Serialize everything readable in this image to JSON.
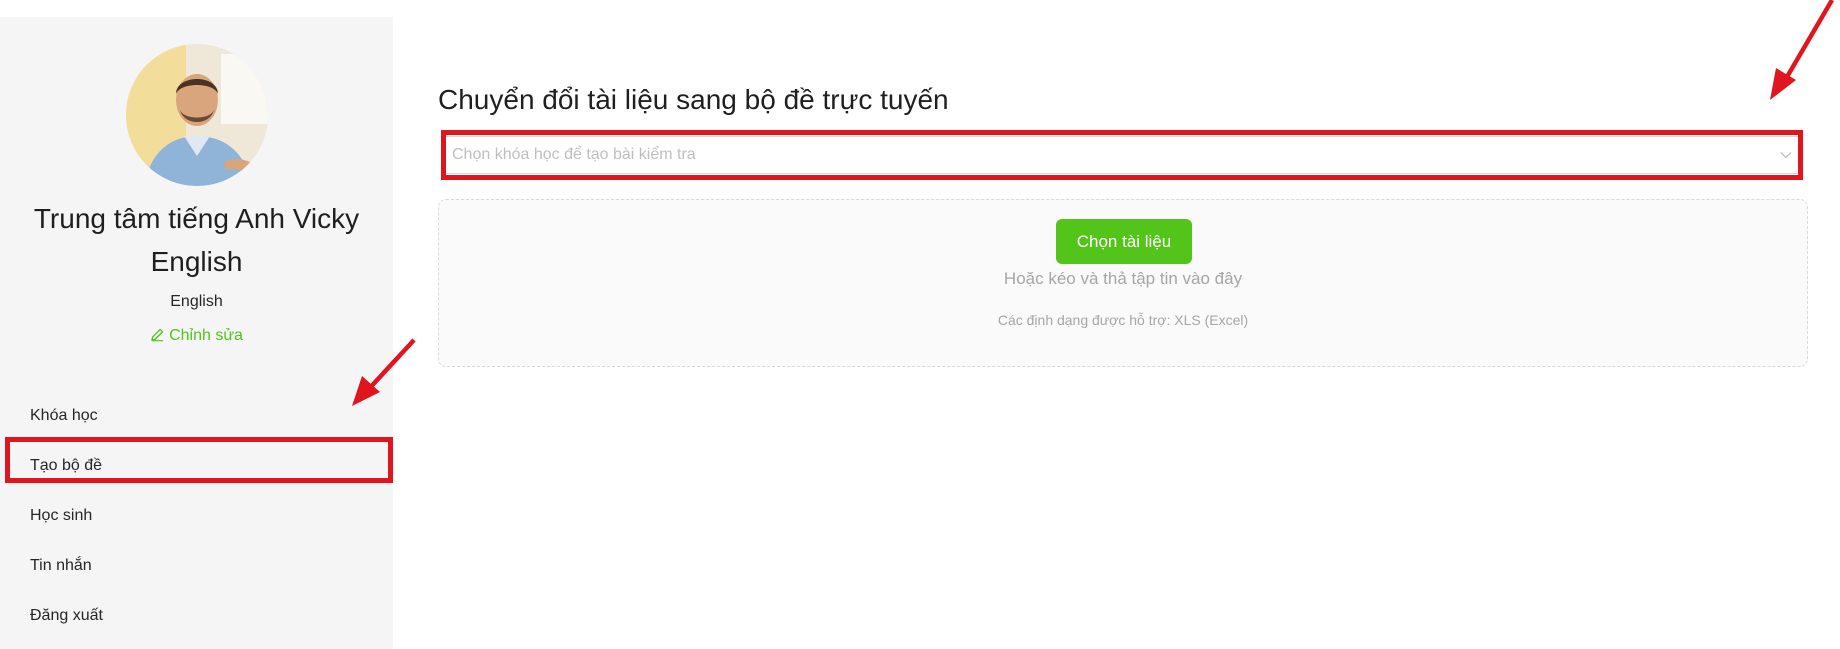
{
  "profile": {
    "name": "Trung tâm tiếng Anh Vicky English",
    "subtitle": "English",
    "edit_label": "Chỉnh sửa"
  },
  "sidebar": {
    "items": [
      {
        "label": "Khóa học"
      },
      {
        "label": "Tạo bộ đề",
        "highlighted": true
      },
      {
        "label": "Học sinh"
      },
      {
        "label": "Tin nhắn"
      },
      {
        "label": "Đăng xuất"
      }
    ]
  },
  "main": {
    "title": "Chuyển đổi tài liệu sang bộ đề trực tuyến",
    "course_select_placeholder": "Chọn khóa học để tạo bài kiểm tra",
    "upload": {
      "button_label": "Chọn tài liệu",
      "drop_hint": "Hoặc kéo và thả tập tin vào đây",
      "formats_hint": "Các định dạng được hỗ trợ: XLS (Excel)"
    }
  },
  "colors": {
    "accent": "#52c41a",
    "annotation": "#e0151e",
    "sidebar_bg": "#f5f5f5"
  },
  "icons": [
    "edit-pencil-icon",
    "chevron-down-icon",
    "annotation-arrow"
  ]
}
